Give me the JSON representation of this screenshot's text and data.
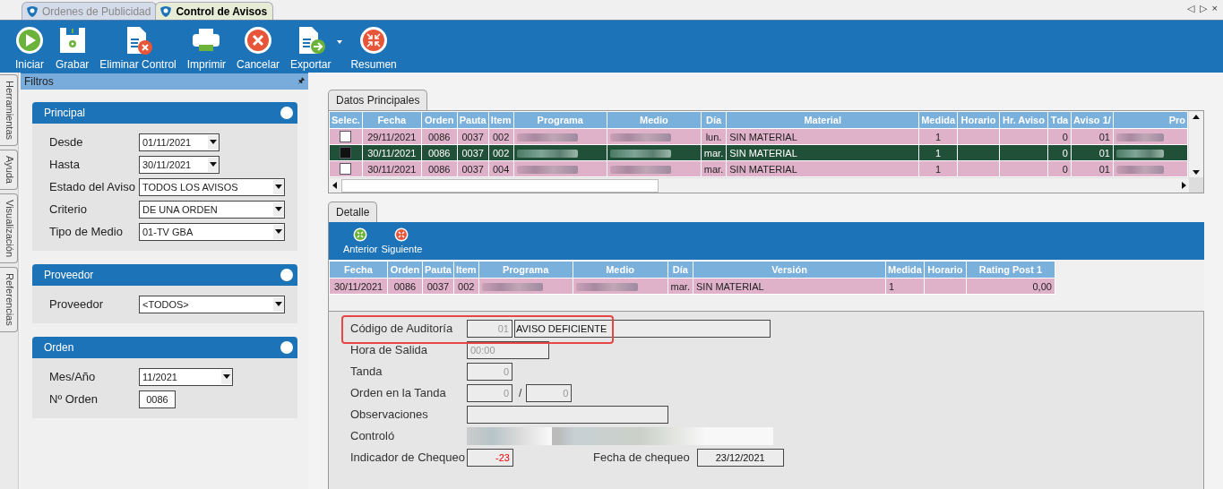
{
  "doc_tabs": [
    {
      "label": "Ordenes de Publicidad",
      "selected": false
    },
    {
      "label": "Control de Avisos",
      "selected": true
    }
  ],
  "nav_controls": [
    "◁",
    "▷",
    "×"
  ],
  "toolbar": [
    {
      "kind": "start",
      "label": "Iniciar"
    },
    {
      "kind": "save",
      "label": "Grabar"
    },
    {
      "kind": "delete",
      "label": "Eliminar Control"
    },
    {
      "kind": "print",
      "label": "Imprimir"
    },
    {
      "kind": "cancel",
      "label": "Cancelar"
    },
    {
      "kind": "export",
      "label": "Exportar",
      "has_menu": true
    },
    {
      "kind": "summary",
      "label": "Resumen"
    }
  ],
  "side_tabs": [
    "Herramientas",
    "Ayuda",
    "Visualización",
    "Referencias"
  ],
  "filters": {
    "title": "Filtros",
    "pin": "🖈",
    "sections": [
      {
        "title": "Principal",
        "fields": [
          {
            "label": "Desde",
            "value": "01/11/2021",
            "kind": "date"
          },
          {
            "label": "Hasta",
            "value": "30/11/2021",
            "kind": "date"
          },
          {
            "label": "Estado del Aviso",
            "value": "TODOS LOS AVISOS",
            "kind": "combo"
          },
          {
            "label": "Criterio",
            "value": "DE UNA ORDEN",
            "kind": "combo"
          },
          {
            "label": "Tipo de Medio",
            "value": "01-TV GBA",
            "kind": "combo"
          }
        ]
      },
      {
        "title": "Proveedor",
        "fields": [
          {
            "label": "Proveedor",
            "value": "<TODOS>",
            "kind": "combo"
          }
        ]
      },
      {
        "title": "Orden",
        "fields": [
          {
            "label": "Mes/Año",
            "value": "11/2021",
            "kind": "date"
          },
          {
            "label": "Nº Orden",
            "value": "0086",
            "kind": "text"
          }
        ]
      }
    ]
  },
  "main_tab": {
    "label": "Datos Principales"
  },
  "main_table": {
    "columns": [
      {
        "label": "Selec.",
        "kind": "check"
      },
      {
        "label": "Fecha",
        "kind": "text"
      },
      {
        "label": "Orden",
        "kind": "text"
      },
      {
        "label": "Pauta",
        "kind": "text"
      },
      {
        "label": "Item",
        "kind": "text"
      },
      {
        "label": "Programa",
        "kind": "blurred"
      },
      {
        "label": "Medio",
        "kind": "blurred"
      },
      {
        "label": "Día",
        "kind": "text"
      },
      {
        "label": "Material",
        "kind": "left"
      },
      {
        "label": "Medida",
        "kind": "text"
      },
      {
        "label": "Horario",
        "kind": "text"
      },
      {
        "label": "Hr. Aviso",
        "kind": "text"
      },
      {
        "label": "Tda",
        "kind": "num"
      },
      {
        "label": "Aviso 1/",
        "kind": "num"
      },
      {
        "label": "Pro",
        "kind": "blurred"
      }
    ],
    "rows": [
      {
        "selected": false,
        "checked": false,
        "cells": [
          "",
          "29/11/2021",
          "0086",
          "0037",
          "002",
          "",
          "",
          "lun.",
          "SIN MATERIAL",
          "1",
          "",
          "",
          "0",
          "01",
          ""
        ]
      },
      {
        "selected": true,
        "checked": false,
        "cells": [
          "",
          "30/11/2021",
          "0086",
          "0037",
          "002",
          "",
          "",
          "mar.",
          "SIN MATERIAL",
          "1",
          "",
          "",
          "0",
          "01",
          ""
        ]
      },
      {
        "selected": false,
        "checked": false,
        "cells": [
          "",
          "30/11/2021",
          "0086",
          "0037",
          "004",
          "",
          "",
          "mar.",
          "SIN MATERIAL",
          "1",
          "",
          "",
          "0",
          "01",
          ""
        ]
      }
    ]
  },
  "detail_tab": {
    "label": "Detalle"
  },
  "detail_toolbar": [
    {
      "kind": "prev",
      "label": "Anterior"
    },
    {
      "kind": "next",
      "label": "Siguiente"
    }
  ],
  "detail_table": {
    "columns": [
      {
        "label": "Fecha",
        "kind": "text"
      },
      {
        "label": "Orden",
        "kind": "text"
      },
      {
        "label": "Pauta",
        "kind": "text"
      },
      {
        "label": "Item",
        "kind": "text"
      },
      {
        "label": "Programa",
        "kind": "blurred"
      },
      {
        "label": "Medio",
        "kind": "blurred"
      },
      {
        "label": "Día",
        "kind": "text"
      },
      {
        "label": "Versión",
        "kind": "left"
      },
      {
        "label": "Medida",
        "kind": "left"
      },
      {
        "label": "Horario",
        "kind": "text"
      },
      {
        "label": "Rating Post 1",
        "kind": "num"
      }
    ],
    "rows": [
      {
        "cells": [
          "30/11/2021",
          "0086",
          "0037",
          "002",
          "",
          "",
          "mar.",
          "SIN MATERIAL",
          "1",
          "",
          "0,00"
        ]
      }
    ]
  },
  "form": [
    {
      "label": "Código de Auditoría",
      "highlight": true,
      "inputs": [
        {
          "value": "01",
          "kind": "code"
        },
        {
          "value": "AVISO DEFICIENTE",
          "kind": "wide"
        }
      ]
    },
    {
      "label": "Hora de Salida",
      "inputs": [
        {
          "value": "00:00",
          "kind": "time"
        }
      ]
    },
    {
      "label": "Tanda",
      "inputs": [
        {
          "value": "0",
          "kind": "code"
        }
      ]
    },
    {
      "label": "Orden en la Tanda",
      "separator": "/",
      "inputs": [
        {
          "value": "0",
          "kind": "code"
        },
        {
          "value": "0",
          "kind": "code"
        }
      ]
    },
    {
      "label": "Observaciones",
      "inputs": [
        {
          "kind": "memo"
        }
      ]
    },
    {
      "label": "Controló",
      "inputs": [
        {
          "kind": "blurred_short"
        },
        {
          "kind": "blurred_long"
        }
      ]
    },
    {
      "label": "Indicador de Chequeo",
      "inputs": [
        {
          "value": "-23",
          "kind": "negative"
        }
      ],
      "extra": {
        "label": "Fecha de chequeo",
        "value": "23/12/2021"
      }
    }
  ]
}
